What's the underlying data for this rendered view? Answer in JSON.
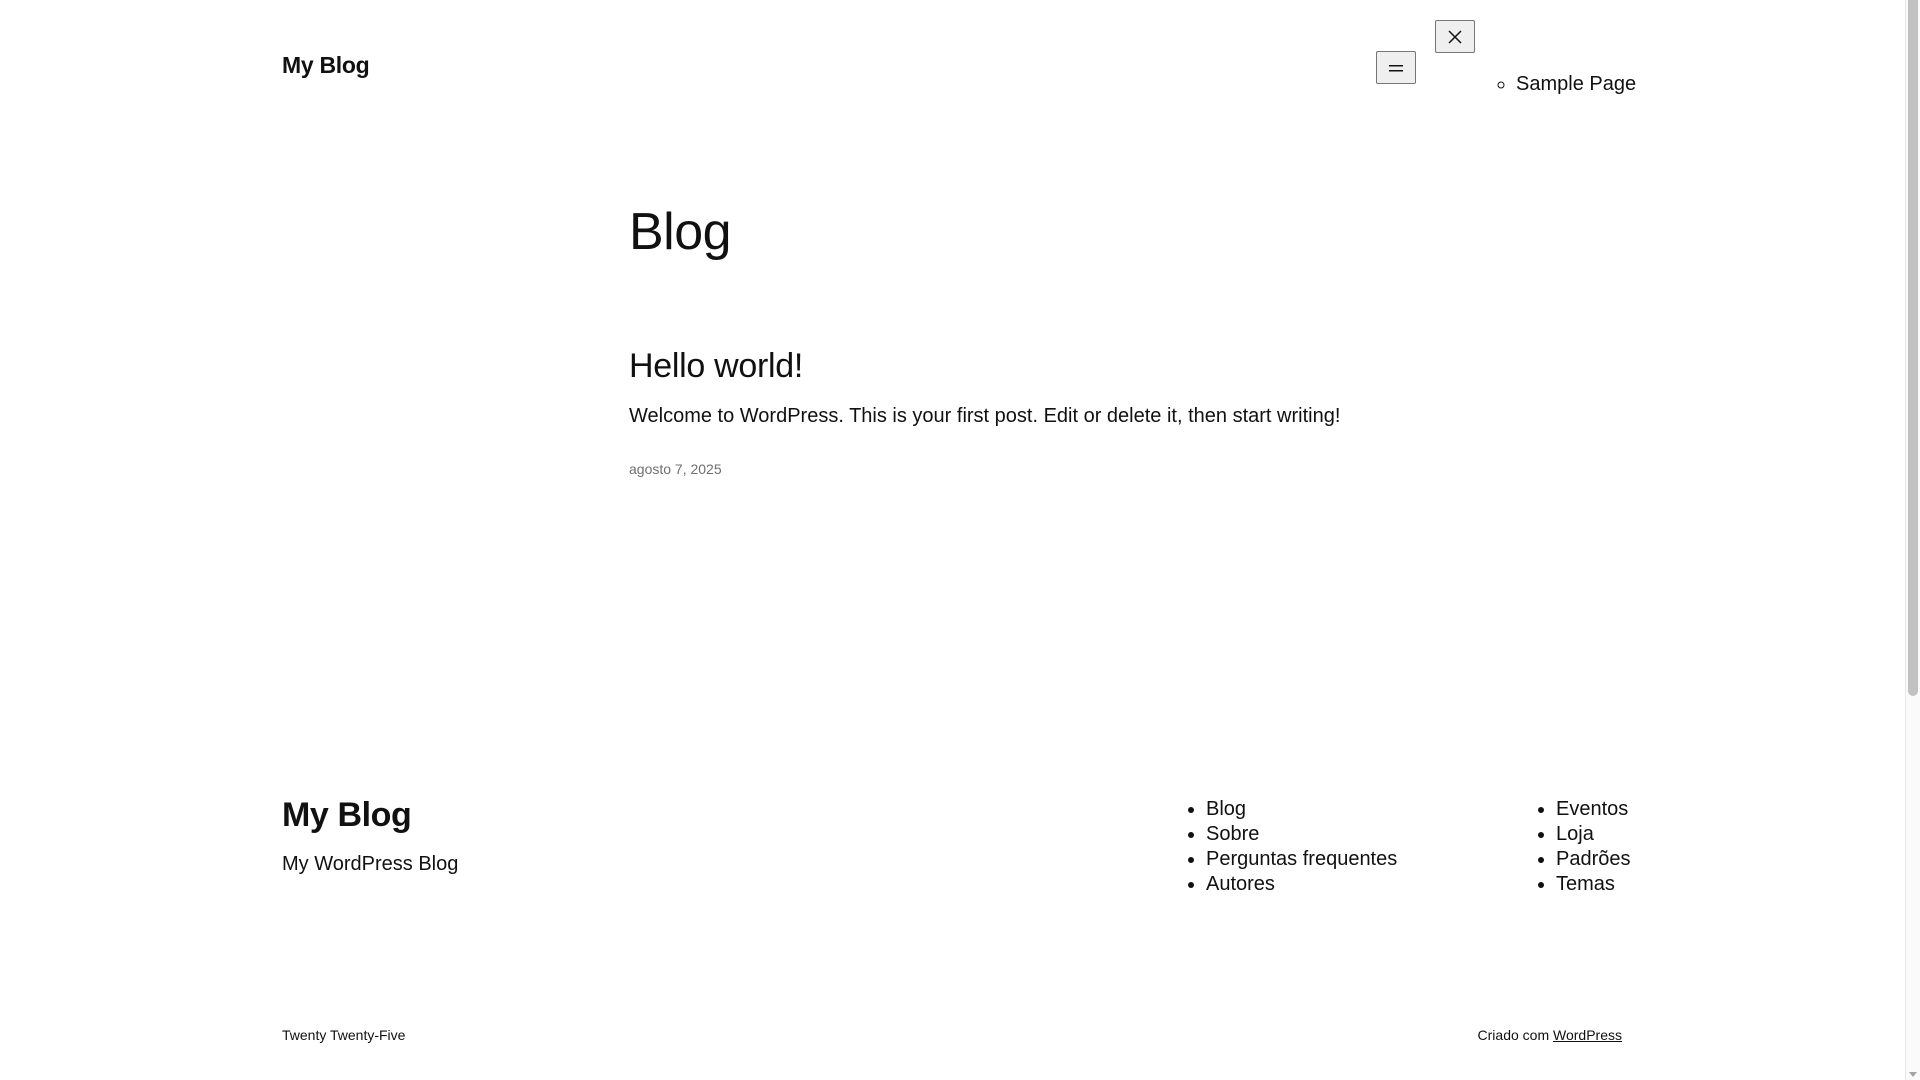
{
  "header": {
    "site_title": "My Blog",
    "menu_toggle_icon": "hamburger-icon",
    "menu_close_icon": "close-icon",
    "nav_items": [
      {
        "label": "Sample Page"
      }
    ]
  },
  "main": {
    "heading": "Blog",
    "posts": [
      {
        "title": "Hello world!",
        "excerpt": "Welcome to WordPress. This is your first post. Edit or delete it, then start writing!",
        "date": "agosto 7, 2025"
      }
    ]
  },
  "footer": {
    "site_title": "My Blog",
    "tagline": "My WordPress Blog",
    "nav_column_1": [
      {
        "label": "Blog"
      },
      {
        "label": "Sobre"
      },
      {
        "label": "Perguntas frequentes"
      },
      {
        "label": "Autores"
      }
    ],
    "nav_column_2": [
      {
        "label": "Eventos"
      },
      {
        "label": "Loja"
      },
      {
        "label": "Padrões"
      },
      {
        "label": "Temas"
      }
    ],
    "theme_credit": "Twenty Twenty-Five",
    "powered_prefix": "Criado com",
    "powered_link": "WordPress"
  },
  "colors": {
    "text": "#111111",
    "muted": "#6f6f6f",
    "background": "#ffffff",
    "button_border": "#767676"
  }
}
